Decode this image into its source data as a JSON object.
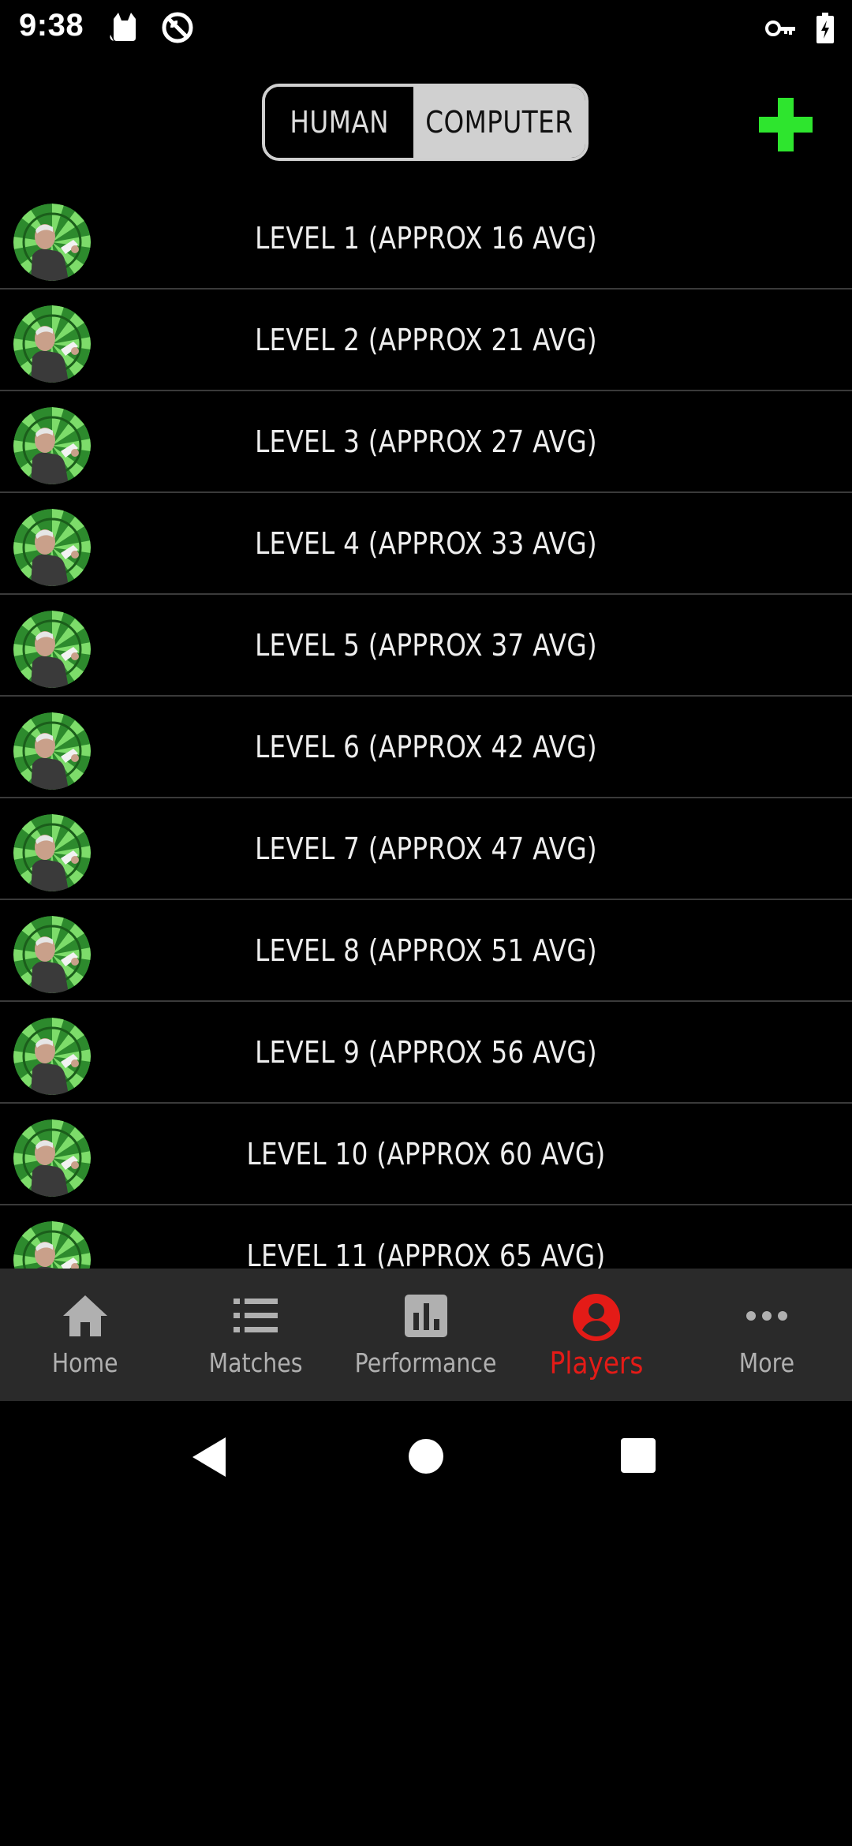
{
  "status_bar": {
    "time": "9:38",
    "left_icons": [
      "cat-icon",
      "sync-off-icon"
    ],
    "right_icons": [
      "key-icon",
      "battery-charging-icon"
    ]
  },
  "header": {
    "segments": [
      {
        "label": "HUMAN",
        "selected": false
      },
      {
        "label": "COMPUTER",
        "selected": true
      }
    ],
    "add_icon": "plus-icon",
    "accent": "#2ee52e"
  },
  "players": [
    {
      "label": "LEVEL 1 (APPROX 16 AVG)"
    },
    {
      "label": "LEVEL 2 (APPROX 21 AVG)"
    },
    {
      "label": "LEVEL 3 (APPROX 27 AVG)"
    },
    {
      "label": "LEVEL 4 (APPROX 33 AVG)"
    },
    {
      "label": "LEVEL 5 (APPROX 37 AVG)"
    },
    {
      "label": "LEVEL 6 (APPROX 42 AVG)"
    },
    {
      "label": "LEVEL 7 (APPROX 47 AVG)"
    },
    {
      "label": "LEVEL 8 (APPROX 51 AVG)"
    },
    {
      "label": "LEVEL 9 (APPROX 56 AVG)"
    },
    {
      "label": "LEVEL 10 (APPROX 60 AVG)"
    },
    {
      "label": "LEVEL 11 (APPROX 65 AVG)"
    }
  ],
  "tabbar": {
    "tabs": [
      {
        "label": "Home",
        "icon": "home-icon",
        "active": false
      },
      {
        "label": "Matches",
        "icon": "list-icon",
        "active": false
      },
      {
        "label": "Performance",
        "icon": "bar-chart-icon",
        "active": false
      },
      {
        "label": "Players",
        "icon": "account-circle-icon",
        "active": true
      },
      {
        "label": "More",
        "icon": "more-dots-icon",
        "active": false
      }
    ],
    "active_color": "#e41b17"
  },
  "navbar": {
    "buttons": [
      "back-icon",
      "home-circle-icon",
      "recents-square-icon"
    ]
  }
}
